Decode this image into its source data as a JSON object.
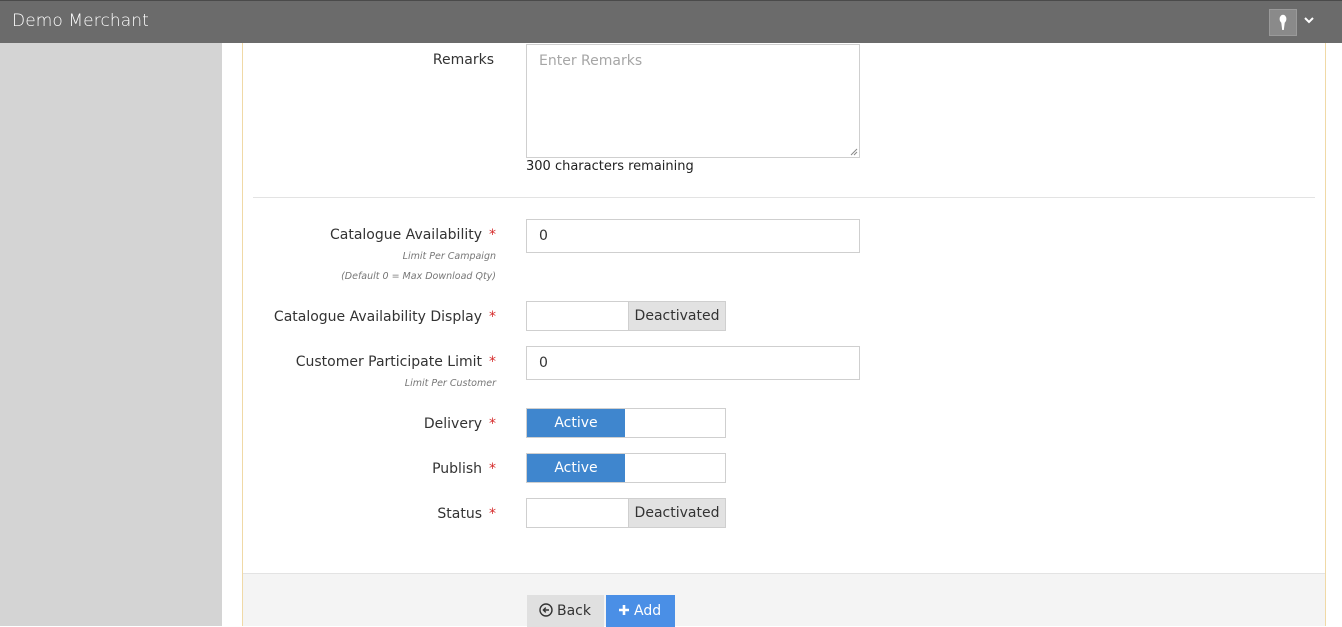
{
  "header": {
    "title": "Demo Merchant",
    "avatar_icon": "user-silhouette-icon",
    "menu_icon": "chevron-down-icon"
  },
  "form": {
    "remarks": {
      "label": "Remarks",
      "placeholder": "Enter Remarks",
      "value": "",
      "remaining": "300 characters remaining"
    },
    "catalogue_availability": {
      "label": "Catalogue Availability",
      "required": "*",
      "hint1": "Limit Per Campaign",
      "hint2": "(Default 0 = Max Download Qty)",
      "value": "0"
    },
    "catalogue_availability_display": {
      "label": "Catalogue Availability Display",
      "required": "*",
      "state": "Deactivated"
    },
    "customer_participate_limit": {
      "label": "Customer Participate Limit",
      "required": "*",
      "hint": "Limit Per Customer",
      "value": "0"
    },
    "delivery": {
      "label": "Delivery",
      "required": "*",
      "state": "Active"
    },
    "publish": {
      "label": "Publish",
      "required": "*",
      "state": "Active"
    },
    "status": {
      "label": "Status",
      "required": "*",
      "state": "Deactivated"
    }
  },
  "footer": {
    "back_label": "Back",
    "back_icon": "circle-arrow-left-icon",
    "add_label": "Add",
    "add_icon": "plus-icon"
  },
  "colors": {
    "active": "#3f86ce",
    "add_button": "#4a8fe6",
    "topbar": "#6b6b6b",
    "sidebar": "#d4d4d4",
    "required": "#d62b2b"
  }
}
